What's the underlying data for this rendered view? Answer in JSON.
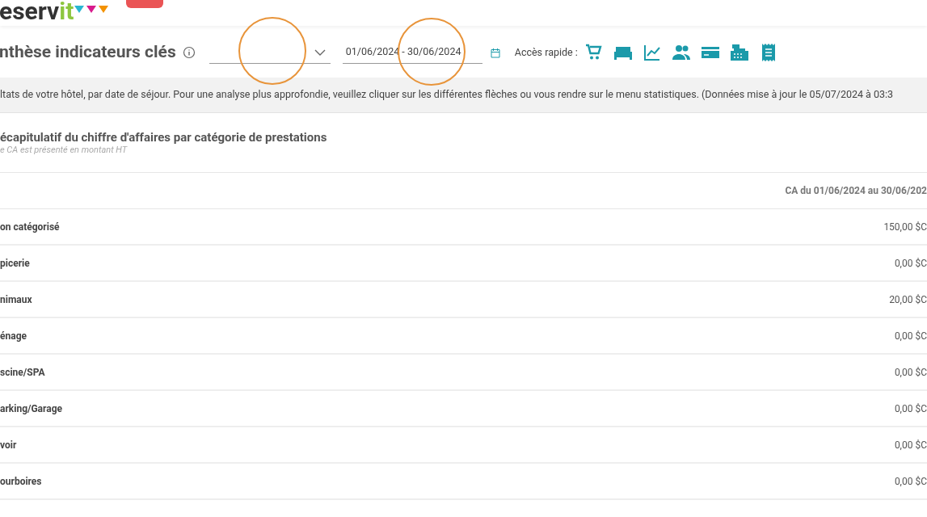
{
  "logo": {
    "text_dark": "eserv",
    "text_green": "it"
  },
  "title": "nthèse indicateurs clés",
  "filter": {
    "date_range": "01/06/2024 - 30/06/2024"
  },
  "quick_access": {
    "label": "Accès rapide :",
    "icons": [
      {
        "kind": "cart"
      },
      {
        "kind": "bed"
      },
      {
        "kind": "chart"
      },
      {
        "kind": "people"
      },
      {
        "kind": "card"
      },
      {
        "kind": "register"
      },
      {
        "kind": "receipt"
      }
    ]
  },
  "info": "ltats de votre hôtel, par date de séjour. Pour une analyse plus approfondie, veuillez cliquer sur les différentes flèches ou vous rendre sur le menu statistiques. (Données mise à jour le 05/07/2024 à 03:3",
  "section": {
    "title": "écapitulatif du chiffre d'affaires par catégorie de prestations",
    "subtitle": "e CA est présenté en montant HT"
  },
  "table": {
    "column_header": "CA du 01/06/2024 au 30/06/202",
    "rows": [
      {
        "label": "on catégorisé",
        "value": "150,00 $C"
      },
      {
        "label": "picerie",
        "value": "0,00 $C"
      },
      {
        "label": "nimaux",
        "value": "20,00 $C"
      },
      {
        "label": "énage",
        "value": "0,00 $C"
      },
      {
        "label": "scine/SPA",
        "value": "0,00 $C"
      },
      {
        "label": "arking/Garage",
        "value": "0,00 $C"
      },
      {
        "label": "voir",
        "value": "0,00 $C"
      },
      {
        "label": "ourboires",
        "value": "0,00 $C"
      }
    ]
  },
  "highlights": [
    {
      "kind": "circle"
    },
    {
      "kind": "circle"
    }
  ]
}
